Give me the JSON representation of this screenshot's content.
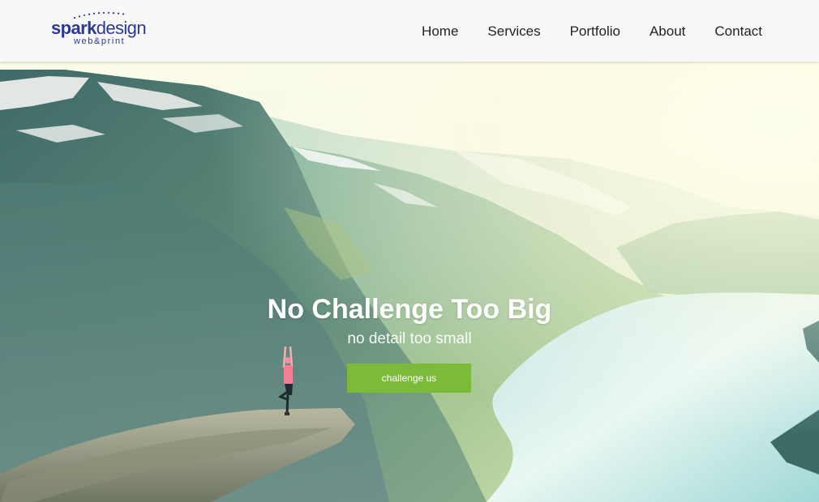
{
  "brand": {
    "name_part1": "spark",
    "name_part2": "design",
    "tagline": "web&print",
    "color": "#2a3a93"
  },
  "nav": {
    "items": [
      {
        "label": "Home"
      },
      {
        "label": "Services"
      },
      {
        "label": "Portfolio"
      },
      {
        "label": "About"
      },
      {
        "label": "Contact"
      }
    ]
  },
  "hero": {
    "title": "No Challenge Too Big",
    "subtitle": "no detail too small",
    "cta_label": "challenge us",
    "cta_color": "#7cba3a",
    "image": "mountain-fjord-yoga-photo"
  }
}
